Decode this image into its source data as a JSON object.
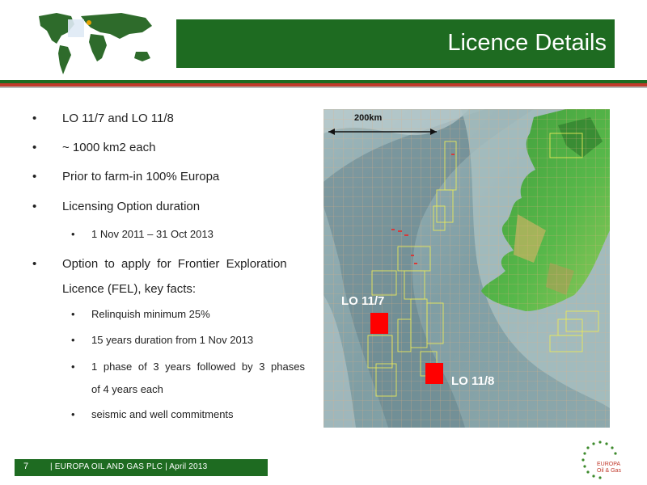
{
  "slide": {
    "title": "Licence Details",
    "bullets": [
      "LO 11/7 and LO 11/8",
      "~ 1000 km2 each",
      "Prior to farm-in 100% Europa",
      "Licensing Option duration"
    ],
    "duration_sub": "1 Nov 2011 – 31 Oct  2013",
    "fel_line1": "Option to apply for Frontier Exploration",
    "fel_line2": "Licence (FEL), key facts:",
    "fel_facts": [
      "Relinquish minimum 25%",
      " 15 years duration from 1 Nov 2013",
      "1 phase of 3 years followed by 3 phases",
      "of 4 years each",
      "seismic and well commitments"
    ]
  },
  "map": {
    "scale_label": "200km",
    "licence_a": "LO 11/7",
    "licence_b": "LO 11/8",
    "licence_color": "#ff0000"
  },
  "footer": {
    "page_number": "7",
    "text": "|  EUROPA OIL AND GAS PLC   |   April 2013"
  },
  "logo": {
    "line1": "EUROPA",
    "line2": "Oil & Gas"
  },
  "colors": {
    "brand_green": "#1e6b21",
    "brand_red": "#c03a2b"
  }
}
